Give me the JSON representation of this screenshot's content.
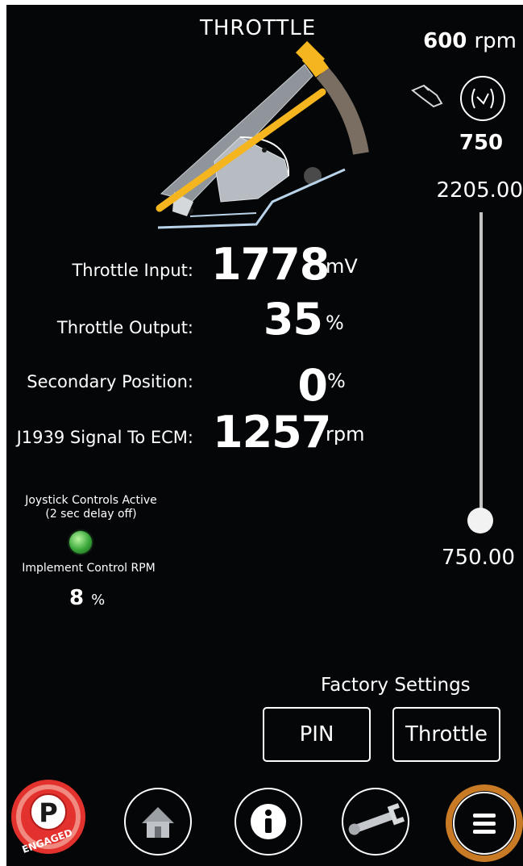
{
  "header": {
    "title": "THROTTLE"
  },
  "engine": {
    "current_rpm": "600",
    "current_rpm_unit": "rpm",
    "idle_rpm": "750",
    "idle_icon": "idle-gauge-icon",
    "foot_icon": "foot-pedal-icon"
  },
  "slider": {
    "max_label": "2205.00",
    "min_label": "750.00",
    "min": 750.0,
    "max": 2205.0,
    "value": 750.0
  },
  "readouts": [
    {
      "label": "Throttle Input:",
      "value": "1778",
      "unit": "mV"
    },
    {
      "label": "Throttle Output:",
      "value": "35",
      "unit": "%"
    },
    {
      "label": "Secondary Position:",
      "value": "0",
      "unit": "%"
    },
    {
      "label": "J1939 Signal To ECM:",
      "value": "1257",
      "unit": "rpm"
    }
  ],
  "joystick": {
    "label_line1": "Joystick Controls Active",
    "label_line2": "(2 sec delay off)",
    "status_color": "#3aa83a"
  },
  "implement": {
    "label": "Implement Control RPM",
    "value": "8",
    "unit": "%"
  },
  "factory": {
    "label": "Factory Settings",
    "pin_button": "PIN",
    "throttle_button": "Throttle"
  },
  "nav": {
    "park_label": "P",
    "park_status": "ENGAGED",
    "items": [
      "home-icon",
      "info-icon",
      "wrench-icon",
      "menu-icon"
    ]
  },
  "colors": {
    "accent": "#f5b51f",
    "park_red": "#e3312d",
    "menu_ring": "#c87a25",
    "throttle_arc": "#7a6e62"
  }
}
